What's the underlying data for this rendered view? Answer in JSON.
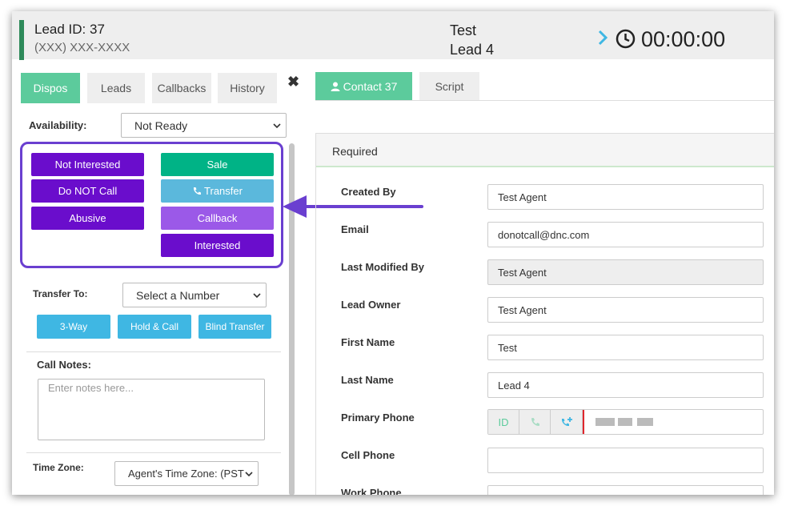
{
  "header": {
    "lead_id": "Lead ID: 37",
    "phone": "(XXX) XXX-XXXX",
    "name_line1": "Test",
    "name_line2": "Lead 4",
    "timer": "00:00:00"
  },
  "left_tabs": [
    "Dispos",
    "Leads",
    "Callbacks",
    "History"
  ],
  "close_symbol": "✖",
  "availability": {
    "label": "Availability:",
    "value": "Not Ready"
  },
  "dispositions": {
    "left": [
      "Not Interested",
      "Do NOT Call",
      "Abusive"
    ],
    "right": [
      "Sale",
      "Transfer",
      "Callback",
      "Interested"
    ]
  },
  "transfer": {
    "label": "Transfer To:",
    "select_value": "Select a Number",
    "buttons": [
      "3-Way",
      "Hold & Call",
      "Blind Transfer"
    ]
  },
  "call_notes": {
    "label": "Call Notes:",
    "placeholder": "Enter notes here..."
  },
  "time_zone": {
    "label": "Time Zone:",
    "value": "Agent's Time Zone: (PST"
  },
  "right_tabs": [
    "Contact 37",
    "Script"
  ],
  "section_title": "Required",
  "fields": [
    {
      "label": "Created By",
      "value": "Test Agent"
    },
    {
      "label": "Email",
      "value": "donotcall@dnc.com"
    },
    {
      "label": "Last Modified By",
      "value": "Test Agent"
    },
    {
      "label": "Lead Owner",
      "value": "Test Agent"
    },
    {
      "label": "First Name",
      "value": "Test"
    },
    {
      "label": "Last Name",
      "value": "Lead 4"
    },
    {
      "label": "Primary Phone",
      "value": ""
    },
    {
      "label": "Cell Phone",
      "value": ""
    },
    {
      "label": "Work Phone",
      "value": ""
    }
  ],
  "phone_buttons": {
    "id": "ID"
  },
  "colors": {
    "active_tab": "#5ccb9c",
    "dispo_purple": "#6a0dcc",
    "sale_green": "#00b386",
    "transfer_blue": "#5bb8dc",
    "callback_lavender": "#9b59e8",
    "transfer_btn": "#3fb7e3",
    "highlight": "#6a3fd0",
    "header_accent": "#2e8a5a"
  },
  "icons": [
    "chevron-right-icon",
    "clock-icon",
    "close-icon",
    "phone-icon",
    "user-icon",
    "caret-down-icon"
  ]
}
